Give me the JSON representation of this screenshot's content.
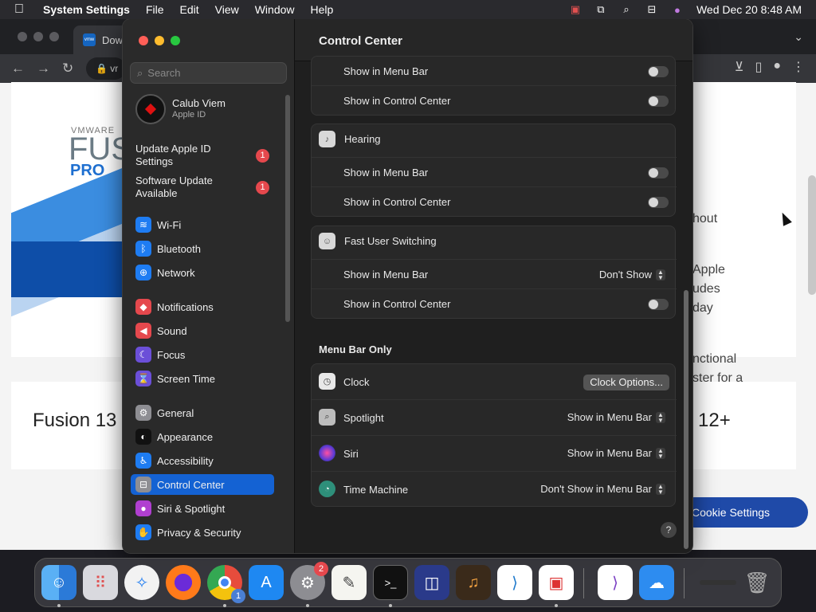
{
  "menubar": {
    "app": "System Settings",
    "items": [
      "File",
      "Edit",
      "View",
      "Window",
      "Help"
    ],
    "clock": "Wed Dec 20  8:48 AM"
  },
  "browser": {
    "tab_title": "Dow",
    "url": "vr",
    "favicon": "vmw",
    "hero_brand": "VMWARE",
    "hero_product": "FUS",
    "hero_edition": "PRO",
    "right_texts": [
      "hout",
      "Apple",
      "udes",
      "day",
      "nctional",
      "ster for a"
    ],
    "fusion13": "Fusion 13",
    "os12": "12+",
    "cookie_button": "Cookie Settings"
  },
  "settings": {
    "search_placeholder": "Search",
    "profile": {
      "name": "Calub Viem",
      "subtitle": "Apple ID"
    },
    "updates": [
      {
        "label": "Update Apple ID Settings",
        "badge": "1"
      },
      {
        "label": "Software Update Available",
        "badge": "1"
      }
    ],
    "sidebar": [
      {
        "label": "Wi-Fi",
        "color": "#1e7cf2",
        "glyph": "≋"
      },
      {
        "label": "Bluetooth",
        "color": "#1e7cf2",
        "glyph": "ᛒ"
      },
      {
        "label": "Network",
        "color": "#1e7cf2",
        "glyph": "⊕"
      },
      {
        "label": "Notifications",
        "color": "#e5484d",
        "glyph": "◆"
      },
      {
        "label": "Sound",
        "color": "#e5484d",
        "glyph": "◀"
      },
      {
        "label": "Focus",
        "color": "#6b4fd8",
        "glyph": "☾"
      },
      {
        "label": "Screen Time",
        "color": "#6b4fd8",
        "glyph": "⌛"
      },
      {
        "label": "General",
        "color": "#8e8e93",
        "glyph": "⚙"
      },
      {
        "label": "Appearance",
        "color": "#111111",
        "glyph": "◐"
      },
      {
        "label": "Accessibility",
        "color": "#1e7cf2",
        "glyph": "♿"
      },
      {
        "label": "Control Center",
        "color": "#8e8e93",
        "glyph": "⊟"
      },
      {
        "label": "Siri & Spotlight",
        "color": "#b03fd0",
        "glyph": "●"
      },
      {
        "label": "Privacy & Security",
        "color": "#1e7cf2",
        "glyph": "✋"
      }
    ],
    "active_item": "Control Center",
    "main": {
      "title": "Control Center",
      "show_in_menu_bar": "Show in Menu Bar",
      "show_in_control_center": "Show in Control Center",
      "hearing": "Hearing",
      "fast_user_switching": "Fast User Switching",
      "fus_menu_value": "Don't Show",
      "menu_bar_only": "Menu Bar Only",
      "clock": "Clock",
      "clock_button": "Clock Options...",
      "spotlight": "Spotlight",
      "spotlight_value": "Show in Menu Bar",
      "siri": "Siri",
      "siri_value": "Show in Menu Bar",
      "time_machine": "Time Machine",
      "time_machine_value": "Don't Show in Menu Bar",
      "help": "?"
    }
  },
  "dock": {
    "system_settings_badge": "2",
    "chrome_badge": "1"
  }
}
